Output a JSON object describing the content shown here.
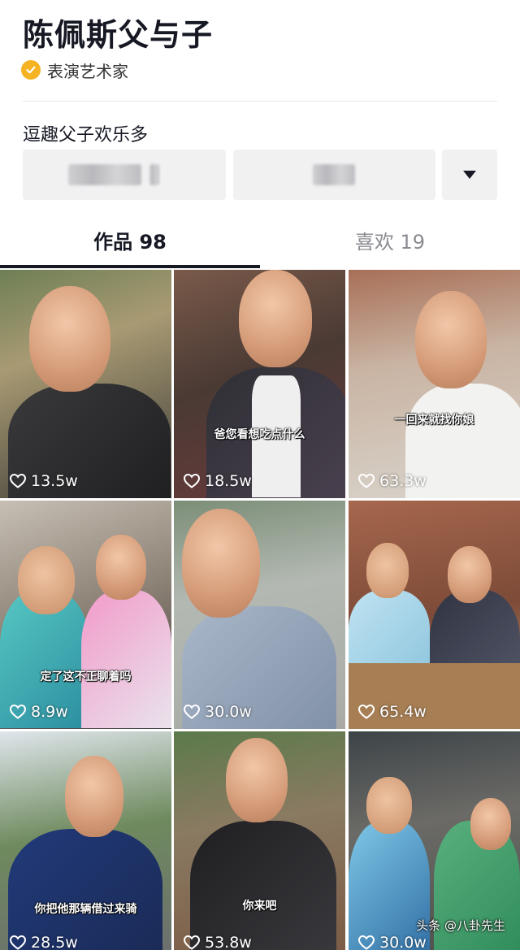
{
  "profile": {
    "name": "陈佩斯父与子",
    "verification": "表演艺术家",
    "bio": "逗趣父子欢乐多"
  },
  "tabs": [
    {
      "label": "作品 98",
      "active": true
    },
    {
      "label": "喜欢 19",
      "active": false
    }
  ],
  "colors": {
    "verify_badge": "#f5b324",
    "active_tab": "#161823",
    "inactive_tab": "#8a8b91"
  },
  "videos": [
    {
      "likes": "13.5w",
      "caption": ""
    },
    {
      "likes": "18.5w",
      "caption": "爸您看想吃点什么"
    },
    {
      "likes": "63.3w",
      "caption": "一回来就找你娘"
    },
    {
      "likes": "8.9w",
      "caption": "定了这不正聊着吗"
    },
    {
      "likes": "30.0w",
      "caption": ""
    },
    {
      "likes": "65.4w",
      "caption": ""
    },
    {
      "likes": "28.5w",
      "caption": "你把他那辆借过来骑"
    },
    {
      "likes": "53.8w",
      "caption": "你来吧"
    },
    {
      "likes": "30.0w",
      "caption": ""
    }
  ],
  "watermark": "头条 @八卦先生",
  "icons": {
    "verify": "check-badge-icon",
    "expand": "triangle-down-icon",
    "like": "heart-outline-icon"
  }
}
